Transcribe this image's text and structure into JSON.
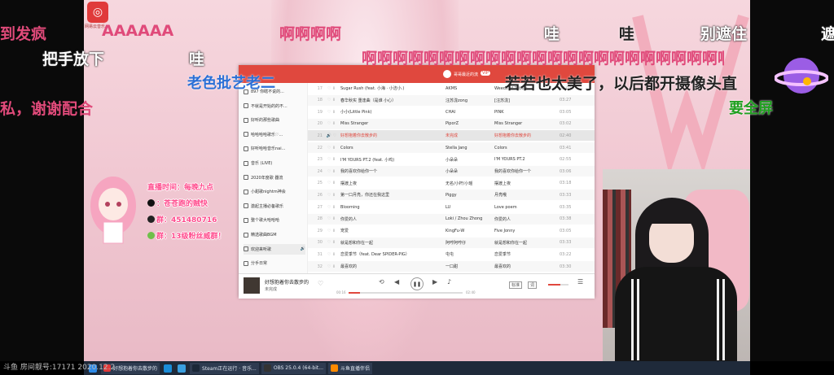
{
  "stream": {
    "room_label": "斗鱼 房间靓号:17171  2020.12.2",
    "netease_logo_text": "网易云音乐"
  },
  "danmaku": [
    {
      "text": "到发疯",
      "style": "pink"
    },
    {
      "text": "AAAAAA",
      "style": "pink"
    },
    {
      "text": "啊啊啊啊",
      "style": "pink"
    },
    {
      "text": "哇",
      "style": "white"
    },
    {
      "text": "哇",
      "style": "grey"
    },
    {
      "text": "别遮住",
      "style": "white"
    },
    {
      "text": "遮",
      "style": "white"
    },
    {
      "text": "把手放下",
      "style": "white"
    },
    {
      "text": "哇",
      "style": "white"
    },
    {
      "text": "啊啊啊啊啊啊啊啊啊啊啊啊啊啊啊啊啊啊啊啊啊啊啊啊啊啊啊啊啊啊啊啊啊",
      "style": "pink"
    },
    {
      "text": "老色批艺老二",
      "style": "blue"
    },
    {
      "text": "若若也太美了，以后都开摄像头直",
      "style": "grey"
    },
    {
      "text": "要全屏",
      "style": "green"
    },
    {
      "text": "私，谢谢配合",
      "style": "pink"
    }
  ],
  "notice": {
    "title": "直播时间：每晚九点",
    "douyin": "：苍苍跑的贼快",
    "qq1": "群：451480716",
    "qq2": "群：13级粉丝威群！"
  },
  "player": {
    "user": "哥哥最近的流",
    "vip": "VIP",
    "playlists": [
      {
        "label": "897 你瞎不说的..."
      },
      {
        "label": "不就是开始的的不..."
      },
      {
        "label": "好听的那些歌曲"
      },
      {
        "label": "哈哈哈哈歌乐♡..."
      },
      {
        "label": "好听哈哈音乐nai..."
      },
      {
        "label": "音乐 (LIVE)"
      },
      {
        "label": "2020年度歌 器流"
      },
      {
        "label": "小甜歌nightm神会"
      },
      {
        "label": "激起主播必备歌乐"
      },
      {
        "label": "整个歌大哈哈哈"
      },
      {
        "label": "精选歌曲BGM"
      },
      {
        "label": "欢迎来听歌",
        "active": true
      },
      {
        "label": "分手日常"
      }
    ],
    "songs": [
      {
        "no": "17",
        "title": "Sugar Rush (feat. 小海 · 小洁小.)",
        "artist": "AKMS",
        "album": "Weeds of Tubert",
        "dur": "02:03"
      },
      {
        "no": "18",
        "title": "春华秋实 重逢曲（是谁 小心）",
        "artist": "汪苏泷zong",
        "album": "[汪苏泷]",
        "dur": "03:27"
      },
      {
        "no": "19",
        "title": "小小(Little Pink)",
        "artist": "CHAI",
        "album": "PINK",
        "dur": "03:05"
      },
      {
        "no": "20",
        "title": "Miss Stranger",
        "artist": "PiporZ",
        "album": "Miss Stranger",
        "dur": "03:02"
      },
      {
        "no": "21",
        "title": "好想抱着你去散步的",
        "artist": "未完成",
        "album": "好想抱着你去散步的",
        "dur": "02:40",
        "playing": true,
        "tag": "SQ"
      },
      {
        "no": "22",
        "title": "Colors",
        "artist": "Stella Jang",
        "album": "Colors",
        "dur": "03:41"
      },
      {
        "no": "23",
        "title": "I'M YOURS PT.2 (feat. 小鸡)",
        "artist": "小朵朵",
        "album": "I'M YOURS PT.2",
        "dur": "02:55"
      },
      {
        "no": "24",
        "title": "我的喜欢你给你一个",
        "artist": "小朵朵",
        "album": "我的喜欢你给你一个",
        "dur": "03:06"
      },
      {
        "no": "25",
        "title": "摆渡上夜",
        "artist": "无名/小杆/小瑶",
        "album": "摆渡上夜",
        "dur": "03:18"
      },
      {
        "no": "26",
        "title": "第一口月亮，你还在我这里",
        "artist": "Piggy",
        "album": "月亮哦",
        "dur": "03:33"
      },
      {
        "no": "27",
        "title": "Blooming",
        "artist": "LU",
        "album": "Love poem",
        "dur": "03:35"
      },
      {
        "no": "28",
        "title": "你爱的人",
        "artist": "Loki / Zhou Zhong",
        "album": "你爱的人",
        "dur": "03:38"
      },
      {
        "no": "29",
        "title": "宠爱",
        "artist": "KingFu-W",
        "album": "Five Jonny",
        "dur": "03:05"
      },
      {
        "no": "30",
        "title": "就是想和你在一起",
        "artist": "阿哼阿哼仔",
        "album": "就是想和你在一起",
        "dur": "03:33"
      },
      {
        "no": "31",
        "title": "恋爱季节（feat. Dear SPIDER-PIG）",
        "artist": "屯屯",
        "album": "恋爱季节",
        "dur": "03:22"
      },
      {
        "no": "32",
        "title": "最喜欢的",
        "artist": "一口甜",
        "album": "最喜欢的",
        "dur": "03:30"
      }
    ],
    "now_playing": {
      "title": "好想抱着你去散步的",
      "artist": "未完成",
      "time_current": "00:16",
      "time_total": "02:40",
      "progress": 0.1,
      "volume": 0.6,
      "lyric_btn": "词",
      "quality_btn": "标准"
    }
  },
  "taskbar": {
    "items": [
      {
        "label": "好想抱着你去散步的",
        "color": "#e03a3a"
      },
      {
        "label": "",
        "color": "#1a8cd8"
      },
      {
        "label": "",
        "color": "#3a9fdf"
      },
      {
        "label": "Steam正在运行 · 音乐...",
        "color": "#1b2838"
      },
      {
        "label": "OBS 25.0.4 (64-bit...",
        "color": "#333"
      },
      {
        "label": "斗鱼直播伴侣",
        "color": "#ff8a00"
      }
    ]
  }
}
